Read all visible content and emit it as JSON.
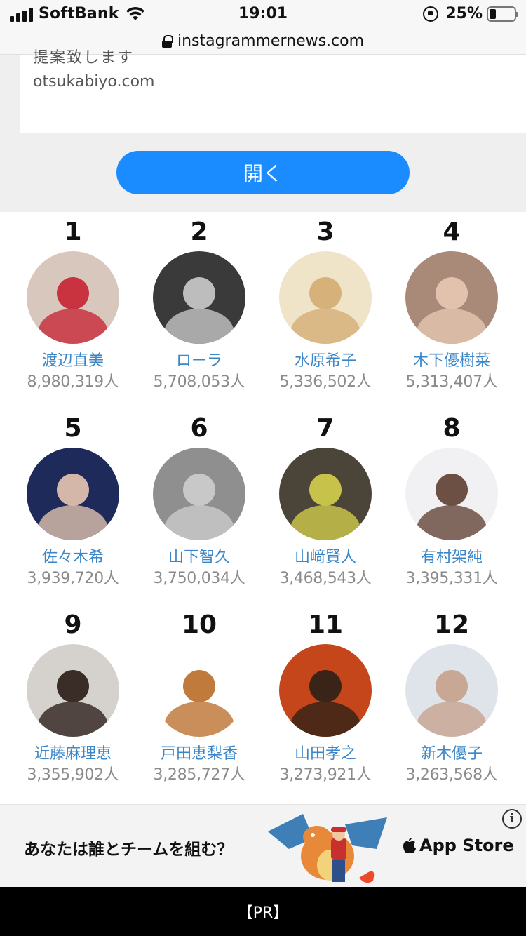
{
  "status_bar": {
    "carrier": "SoftBank",
    "time": "19:01",
    "battery": "25%"
  },
  "browser": {
    "url": "instagrammernews.com"
  },
  "ad": {
    "cut_text": "提案致します",
    "domain": "otsukabiyo.com",
    "open_label": "開く"
  },
  "ranking": [
    {
      "rank": "1",
      "name": "渡辺直美",
      "followers": "8,980,319人",
      "avatar_bg": "#d8c7bd",
      "avatar_fig": "#c9333f"
    },
    {
      "rank": "2",
      "name": "ローラ",
      "followers": "5,708,053人",
      "avatar_bg": "#3a3a3a",
      "avatar_fig": "#bdbdbd"
    },
    {
      "rank": "3",
      "name": "水原希子",
      "followers": "5,336,502人",
      "avatar_bg": "#efe3c8",
      "avatar_fig": "#d7b17a"
    },
    {
      "rank": "4",
      "name": "木下優樹菜",
      "followers": "5,313,407人",
      "avatar_bg": "#a98a78",
      "avatar_fig": "#e2c2ad"
    },
    {
      "rank": "5",
      "name": "佐々木希",
      "followers": "3,939,720人",
      "avatar_bg": "#1e2a5a",
      "avatar_fig": "#d4b7a8"
    },
    {
      "rank": "6",
      "name": "山下智久",
      "followers": "3,750,034人",
      "avatar_bg": "#8f8f8f",
      "avatar_fig": "#c8c8c8"
    },
    {
      "rank": "7",
      "name": "山﨑賢人",
      "followers": "3,468,543人",
      "avatar_bg": "#4a4538",
      "avatar_fig": "#c7c34a"
    },
    {
      "rank": "8",
      "name": "有村架純",
      "followers": "3,395,331人",
      "avatar_bg": "#f1f1f3",
      "avatar_fig": "#6d5044"
    },
    {
      "rank": "9",
      "name": "近藤麻理恵",
      "followers": "3,355,902人",
      "avatar_bg": "#d5d2ce",
      "avatar_fig": "#3a2d28"
    },
    {
      "rank": "10",
      "name": "戸田恵梨香",
      "followers": "3,285,727人",
      "avatar_bg": "#ffffff",
      "avatar_fig": "#c07a3c"
    },
    {
      "rank": "11",
      "name": "山田孝之",
      "followers": "3,273,921人",
      "avatar_bg": "#c5461a",
      "avatar_fig": "#3a2418"
    },
    {
      "rank": "12",
      "name": "新木優子",
      "followers": "3,263,568人",
      "avatar_bg": "#dfe4ea",
      "avatar_fig": "#c9a795"
    }
  ],
  "banner": {
    "text": "あなたは誰とチームを組む？",
    "store_label": "App Store",
    "footer": "【PR】"
  },
  "colors": {
    "accent": "#1a8cff",
    "name_link": "#3a86c8",
    "count_text": "#8a8a8a"
  }
}
